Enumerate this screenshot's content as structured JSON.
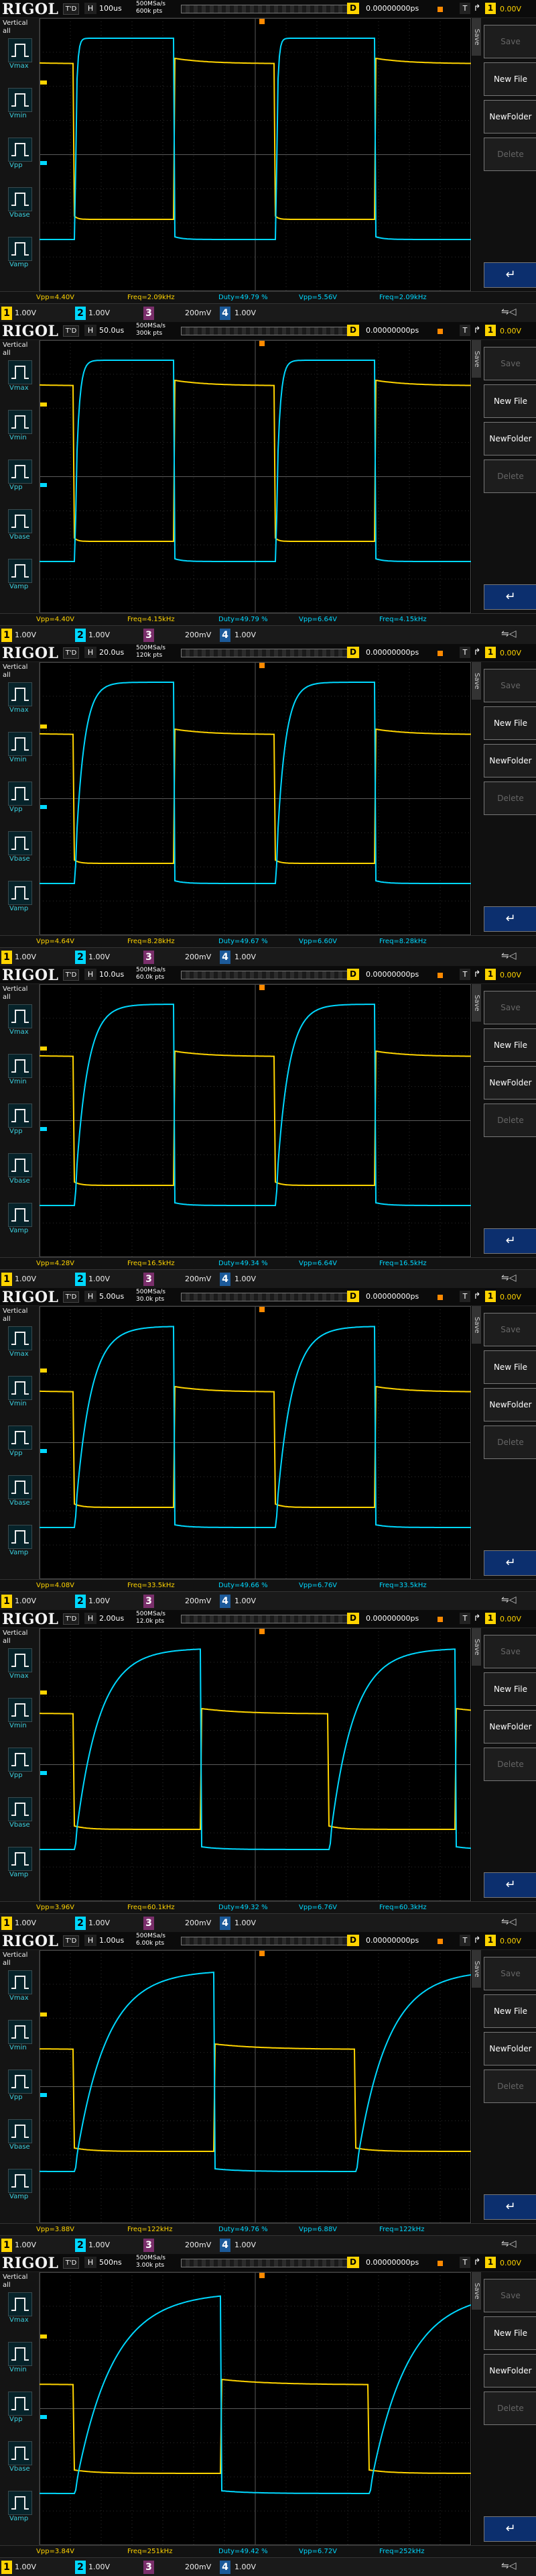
{
  "brand": "RIGOL",
  "td_label": "T'D",
  "h_label": "H",
  "d_label": "D",
  "delay": "0.00000000ps",
  "trigger": {
    "type_label": "T",
    "slope": "↱",
    "coupling_label": "1",
    "level": "0.00V"
  },
  "left_menu": {
    "title": "Vertical\nall",
    "items": [
      "Vmax",
      "Vmin",
      "Vpp",
      "Vbase",
      "Vamp"
    ]
  },
  "right_menu": {
    "tab": "Save",
    "buttons": [
      "Save",
      "New File",
      "NewFolder",
      "Delete"
    ],
    "return": "↵"
  },
  "channels": {
    "ch1_label": "1",
    "ch1_scale": "1.00V",
    "ch2_label": "2",
    "ch2_scale": "1.00V",
    "ch3_label": "3",
    "ch3_scale": "200mV",
    "ch4_label": "4",
    "ch4_scale": "1.00V"
  },
  "colors": {
    "ch1": "#ffd400",
    "ch2": "#00d8ff"
  },
  "screens": [
    {
      "timebase": "100us",
      "srate": "500MSa/s",
      "mem": "600k pts",
      "vpp1": "Vpp=4.40V",
      "freq1": "Freq=2.09kHz",
      "duty": "Duty=49.79 %",
      "vpp2": "Vpp=5.56V",
      "freq2": "Freq=2.09kHz"
    },
    {
      "timebase": "50.0us",
      "srate": "500MSa/s",
      "mem": "300k pts",
      "vpp1": "Vpp=4.40V",
      "freq1": "Freq=4.15kHz",
      "duty": "Duty=49.79 %",
      "vpp2": "Vpp=6.64V",
      "freq2": "Freq=4.15kHz"
    },
    {
      "timebase": "20.0us",
      "srate": "500MSa/s",
      "mem": "120k pts",
      "vpp1": "Vpp=4.64V",
      "freq1": "Freq=8.28kHz",
      "duty": "Duty=49.67 %",
      "vpp2": "Vpp=6.60V",
      "freq2": "Freq=8.28kHz"
    },
    {
      "timebase": "10.0us",
      "srate": "500MSa/s",
      "mem": "60.0k pts",
      "vpp1": "Vpp=4.28V",
      "freq1": "Freq=16.5kHz",
      "duty": "Duty=49.34 %",
      "vpp2": "Vpp=6.64V",
      "freq2": "Freq=16.5kHz"
    },
    {
      "timebase": "5.00us",
      "srate": "500MSa/s",
      "mem": "30.0k pts",
      "vpp1": "Vpp=4.08V",
      "freq1": "Freq=33.5kHz",
      "duty": "Duty=49.66 %",
      "vpp2": "Vpp=6.76V",
      "freq2": "Freq=33.5kHz"
    },
    {
      "timebase": "2.00us",
      "srate": "500MSa/s",
      "mem": "12.0k pts",
      "vpp1": "Vpp=3.96V",
      "freq1": "Freq=60.1kHz",
      "duty": "Duty=49.32 %",
      "vpp2": "Vpp=6.76V",
      "freq2": "Freq=60.3kHz"
    },
    {
      "timebase": "1.00us",
      "srate": "500MSa/s",
      "mem": "6.00k pts",
      "vpp1": "Vpp=3.88V",
      "freq1": "Freq=122kHz",
      "duty": "Duty=49.76 %",
      "vpp2": "Vpp=6.88V",
      "freq2": "Freq=122kHz"
    },
    {
      "timebase": "500ns",
      "srate": "500MSa/s",
      "mem": "3.00k pts",
      "vpp1": "Vpp=3.84V",
      "freq1": "Freq=251kHz",
      "duty": "Duty=49.42 %",
      "vpp2": "Vpp=6.72V",
      "freq2": "Freq=252kHz"
    }
  ]
}
